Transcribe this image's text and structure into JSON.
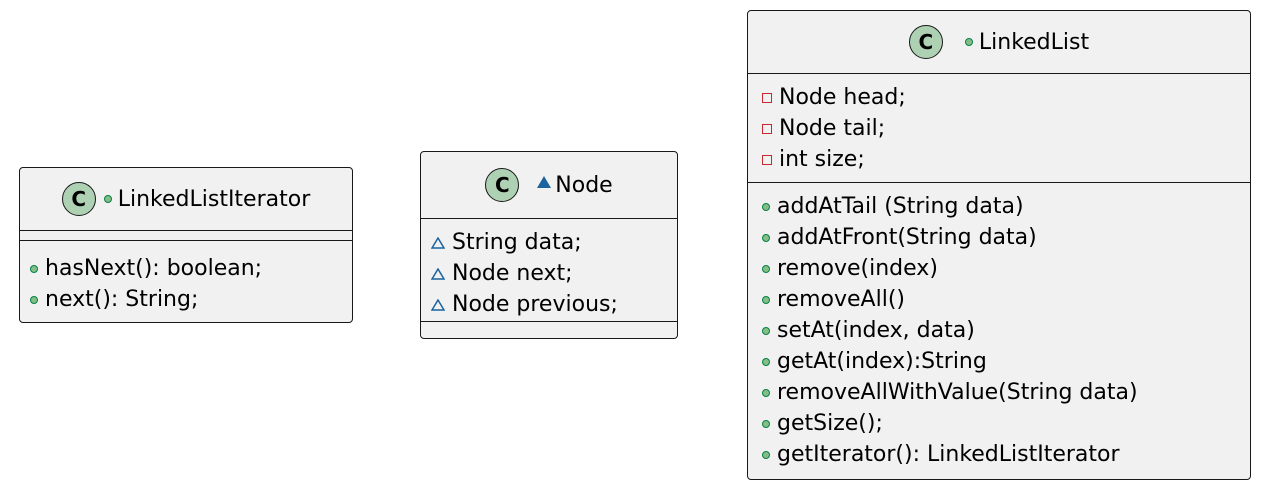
{
  "classes": {
    "linked_list_iterator": {
      "stereo": "C",
      "name": "LinkedListIterator",
      "fields": [],
      "methods": [
        "hasNext(): boolean;",
        "next(): String;"
      ]
    },
    "node": {
      "stereo": "C",
      "name": "Node",
      "fields": [
        "String data;",
        "Node next;",
        "Node previous;"
      ],
      "methods": []
    },
    "linked_list": {
      "stereo": "C",
      "name": "LinkedList",
      "fields": [
        "Node head;",
        "Node tail;",
        "int size;"
      ],
      "methods": [
        "addAtTail (String data)",
        "addAtFront(String data)",
        "remove(index)",
        "removeAll()",
        "setAt(index, data)",
        "getAt(index):String",
        "removeAllWithValue(String data)",
        "getSize();",
        "getIterator(): LinkedListIterator"
      ]
    }
  },
  "colors": {
    "box_fill": "#f1f1f1",
    "border": "#181818",
    "class_circle": "#add1b2",
    "public": "#84be84",
    "package": "#1963a0",
    "private": "#c82930"
  }
}
